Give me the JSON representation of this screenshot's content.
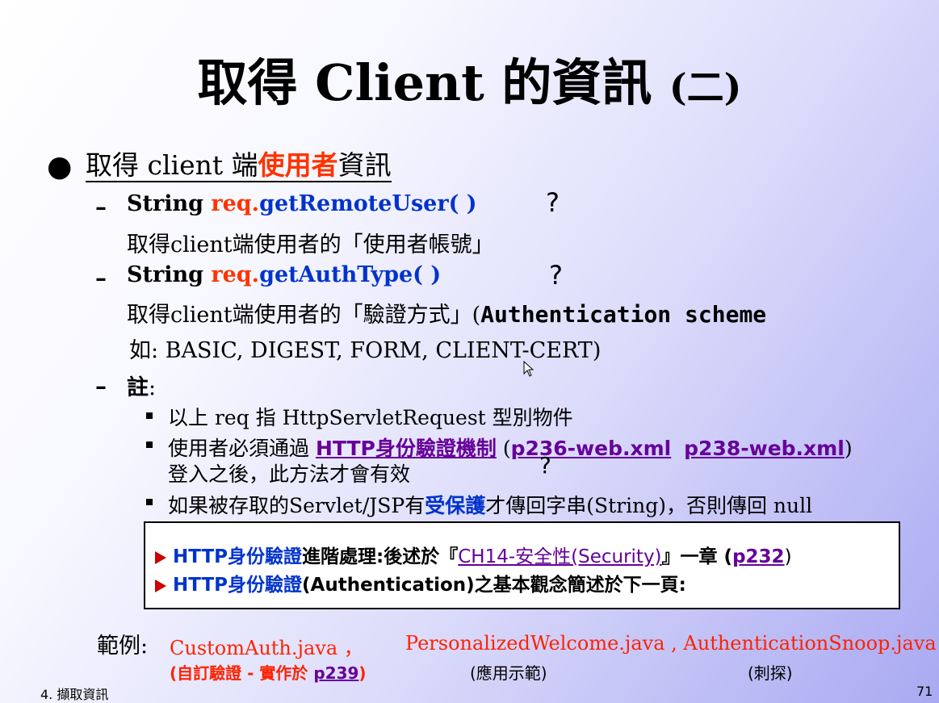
{
  "title": {
    "main": "取得 Client 的資訊 ",
    "paren": "(二)"
  },
  "bullet": {
    "prefix": "取得 client 端",
    "highlight": "使用者",
    "suffix": "資訊"
  },
  "items": [
    {
      "dash": "–",
      "type": "String ",
      "req": "req.",
      "method": "getRemoteUser( )",
      "desc": "取得client端使用者的「使用者帳號」"
    },
    {
      "dash": "–",
      "type": "String  ",
      "req": "req.",
      "method": "getAuthType( )",
      "desc": "取得client端使用者的「驗證方式」(",
      "desc_bold": "Authentication scheme",
      "desc2": "如: BASIC, DIGEST,  FORM,  CLIENT-CERT)"
    },
    {
      "dash": "–",
      "note": "註",
      "colon": ":"
    }
  ],
  "notes": [
    {
      "text": "以上 req 指 HttpServletRequest 型別物件"
    },
    {
      "pre": "使用者必須通過 ",
      "link": "HTTP身份驗證機制",
      "mid": " (",
      "link2": "p236-web.xml",
      "link3": "p238-web.xml",
      "post": ")",
      "line2": "登入之後，此方法才會有效"
    },
    {
      "pre": "如果被存取的Servlet/JSP有",
      "blue": "受保護",
      "post": "才傳回字串(String)，否則傳回 null"
    }
  ],
  "box": {
    "line1": {
      "blue": "HTTP身份驗證",
      "text": "進階處理:後述於『",
      "link": "CH14-安全性(Security)",
      "text2": "』一章 (",
      "link2": "p232",
      "text3": ")"
    },
    "line2": {
      "blue": "HTTP身份驗證",
      "text": "(Authentication)之基本觀念簡述於下一頁:"
    }
  },
  "examples": {
    "label": "範例:",
    "file1": "CustomAuth.java ，",
    "file2": "PersonalizedWelcome.java , AuthenticationSnoop.java",
    "cap1_pre": "(自訂驗證 - 實作於 ",
    "cap1_link": "p239",
    "cap1_post": ")",
    "cap2": "(應用示範)",
    "cap3": "(刺探)"
  },
  "footer": {
    "chapter": "4. 擷取資訊",
    "page": "71"
  },
  "annotation": {
    "question_mark": "?"
  },
  "colors": {
    "accent_red": "#ff3300",
    "method_blue": "#0033cc",
    "link_purple": "#660099"
  }
}
